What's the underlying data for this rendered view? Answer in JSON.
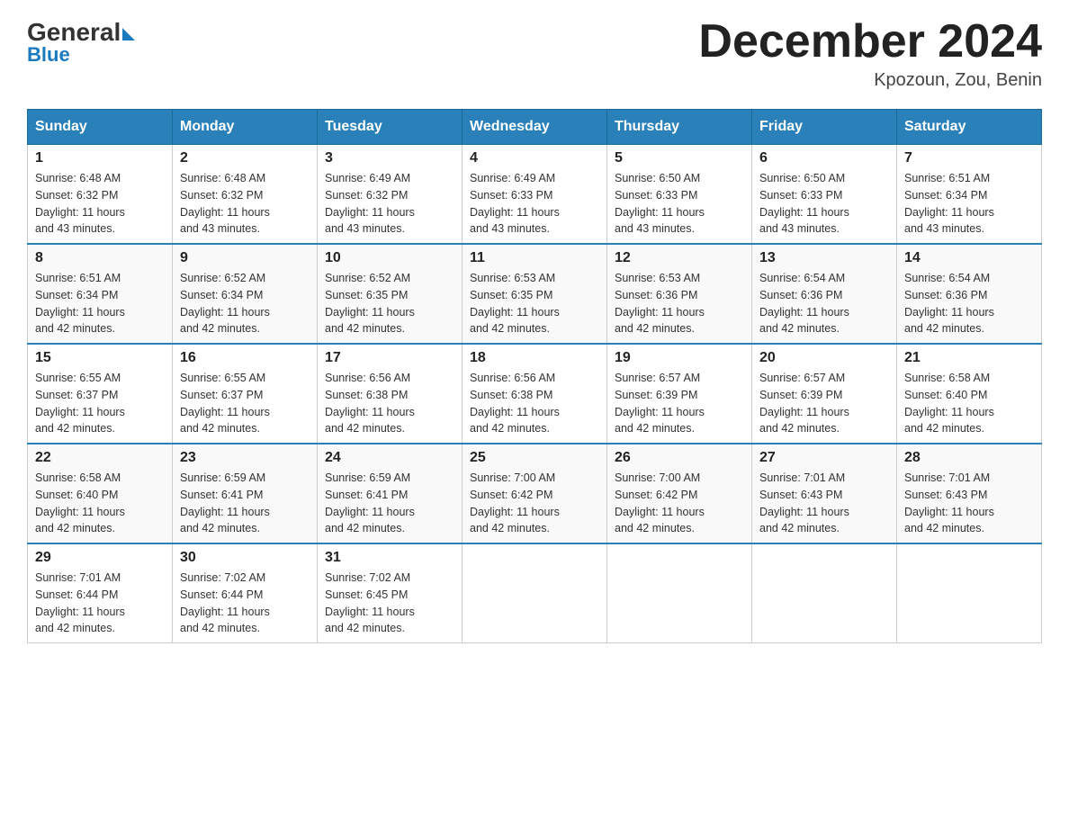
{
  "header": {
    "logo_general": "General",
    "logo_blue": "Blue",
    "month_title": "December 2024",
    "location": "Kpozoun, Zou, Benin"
  },
  "days_of_week": [
    "Sunday",
    "Monday",
    "Tuesday",
    "Wednesday",
    "Thursday",
    "Friday",
    "Saturday"
  ],
  "weeks": [
    [
      {
        "day": "1",
        "sunrise": "6:48 AM",
        "sunset": "6:32 PM",
        "daylight": "11 hours and 43 minutes."
      },
      {
        "day": "2",
        "sunrise": "6:48 AM",
        "sunset": "6:32 PM",
        "daylight": "11 hours and 43 minutes."
      },
      {
        "day": "3",
        "sunrise": "6:49 AM",
        "sunset": "6:32 PM",
        "daylight": "11 hours and 43 minutes."
      },
      {
        "day": "4",
        "sunrise": "6:49 AM",
        "sunset": "6:33 PM",
        "daylight": "11 hours and 43 minutes."
      },
      {
        "day": "5",
        "sunrise": "6:50 AM",
        "sunset": "6:33 PM",
        "daylight": "11 hours and 43 minutes."
      },
      {
        "day": "6",
        "sunrise": "6:50 AM",
        "sunset": "6:33 PM",
        "daylight": "11 hours and 43 minutes."
      },
      {
        "day": "7",
        "sunrise": "6:51 AM",
        "sunset": "6:34 PM",
        "daylight": "11 hours and 43 minutes."
      }
    ],
    [
      {
        "day": "8",
        "sunrise": "6:51 AM",
        "sunset": "6:34 PM",
        "daylight": "11 hours and 42 minutes."
      },
      {
        "day": "9",
        "sunrise": "6:52 AM",
        "sunset": "6:34 PM",
        "daylight": "11 hours and 42 minutes."
      },
      {
        "day": "10",
        "sunrise": "6:52 AM",
        "sunset": "6:35 PM",
        "daylight": "11 hours and 42 minutes."
      },
      {
        "day": "11",
        "sunrise": "6:53 AM",
        "sunset": "6:35 PM",
        "daylight": "11 hours and 42 minutes."
      },
      {
        "day": "12",
        "sunrise": "6:53 AM",
        "sunset": "6:36 PM",
        "daylight": "11 hours and 42 minutes."
      },
      {
        "day": "13",
        "sunrise": "6:54 AM",
        "sunset": "6:36 PM",
        "daylight": "11 hours and 42 minutes."
      },
      {
        "day": "14",
        "sunrise": "6:54 AM",
        "sunset": "6:36 PM",
        "daylight": "11 hours and 42 minutes."
      }
    ],
    [
      {
        "day": "15",
        "sunrise": "6:55 AM",
        "sunset": "6:37 PM",
        "daylight": "11 hours and 42 minutes."
      },
      {
        "day": "16",
        "sunrise": "6:55 AM",
        "sunset": "6:37 PM",
        "daylight": "11 hours and 42 minutes."
      },
      {
        "day": "17",
        "sunrise": "6:56 AM",
        "sunset": "6:38 PM",
        "daylight": "11 hours and 42 minutes."
      },
      {
        "day": "18",
        "sunrise": "6:56 AM",
        "sunset": "6:38 PM",
        "daylight": "11 hours and 42 minutes."
      },
      {
        "day": "19",
        "sunrise": "6:57 AM",
        "sunset": "6:39 PM",
        "daylight": "11 hours and 42 minutes."
      },
      {
        "day": "20",
        "sunrise": "6:57 AM",
        "sunset": "6:39 PM",
        "daylight": "11 hours and 42 minutes."
      },
      {
        "day": "21",
        "sunrise": "6:58 AM",
        "sunset": "6:40 PM",
        "daylight": "11 hours and 42 minutes."
      }
    ],
    [
      {
        "day": "22",
        "sunrise": "6:58 AM",
        "sunset": "6:40 PM",
        "daylight": "11 hours and 42 minutes."
      },
      {
        "day": "23",
        "sunrise": "6:59 AM",
        "sunset": "6:41 PM",
        "daylight": "11 hours and 42 minutes."
      },
      {
        "day": "24",
        "sunrise": "6:59 AM",
        "sunset": "6:41 PM",
        "daylight": "11 hours and 42 minutes."
      },
      {
        "day": "25",
        "sunrise": "7:00 AM",
        "sunset": "6:42 PM",
        "daylight": "11 hours and 42 minutes."
      },
      {
        "day": "26",
        "sunrise": "7:00 AM",
        "sunset": "6:42 PM",
        "daylight": "11 hours and 42 minutes."
      },
      {
        "day": "27",
        "sunrise": "7:01 AM",
        "sunset": "6:43 PM",
        "daylight": "11 hours and 42 minutes."
      },
      {
        "day": "28",
        "sunrise": "7:01 AM",
        "sunset": "6:43 PM",
        "daylight": "11 hours and 42 minutes."
      }
    ],
    [
      {
        "day": "29",
        "sunrise": "7:01 AM",
        "sunset": "6:44 PM",
        "daylight": "11 hours and 42 minutes."
      },
      {
        "day": "30",
        "sunrise": "7:02 AM",
        "sunset": "6:44 PM",
        "daylight": "11 hours and 42 minutes."
      },
      {
        "day": "31",
        "sunrise": "7:02 AM",
        "sunset": "6:45 PM",
        "daylight": "11 hours and 42 minutes."
      },
      null,
      null,
      null,
      null
    ]
  ],
  "labels": {
    "sunrise": "Sunrise:",
    "sunset": "Sunset:",
    "daylight": "Daylight:"
  }
}
